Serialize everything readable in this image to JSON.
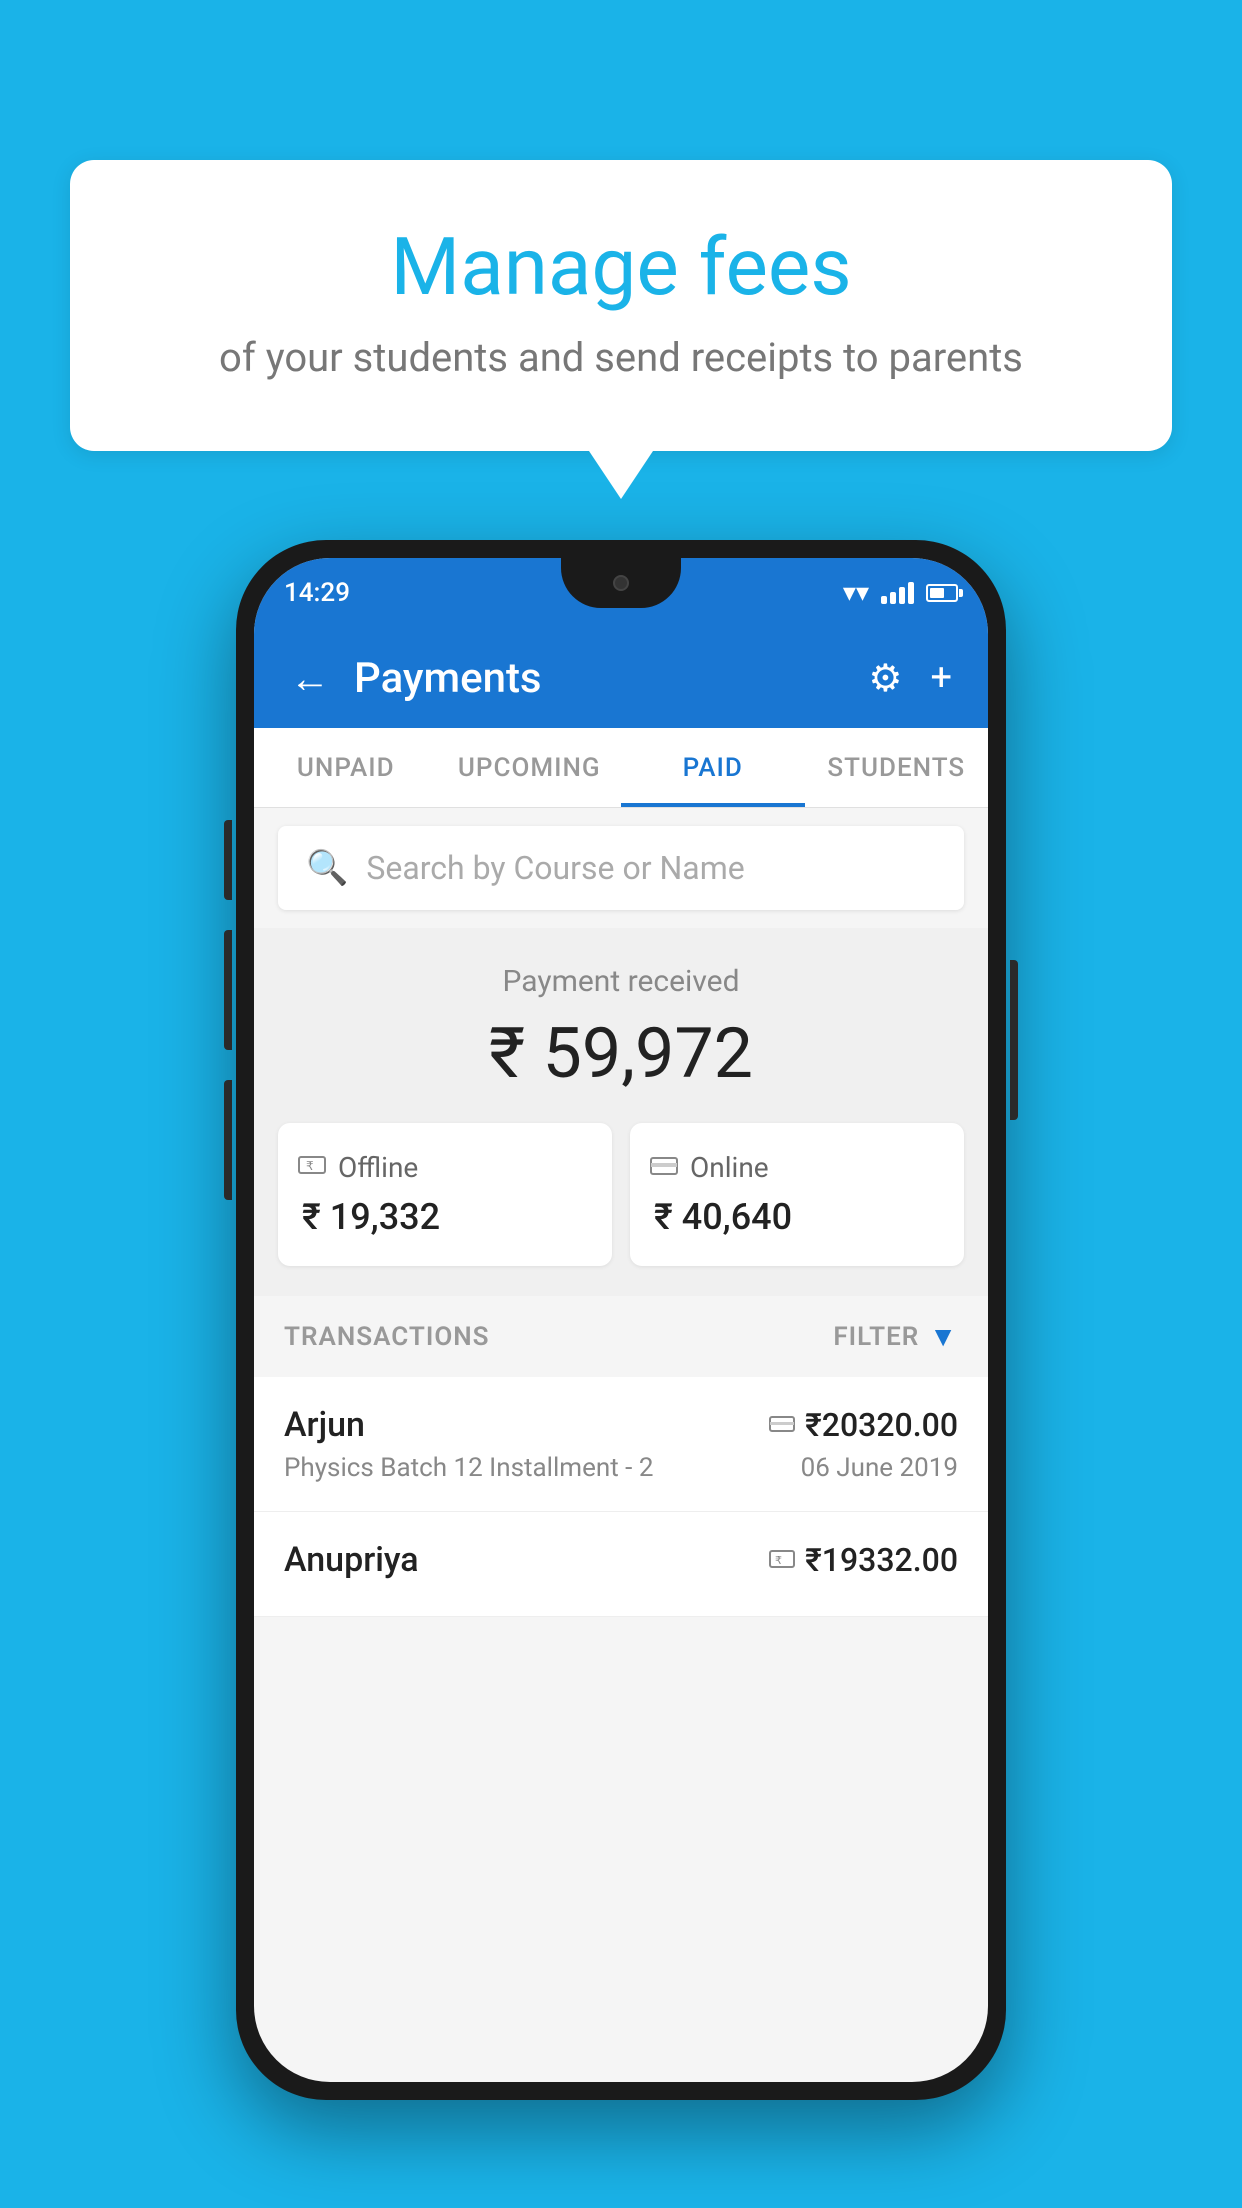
{
  "background_color": "#1ab3e8",
  "speech_bubble": {
    "title": "Manage fees",
    "subtitle": "of your students and send receipts to parents"
  },
  "status_bar": {
    "time": "14:29"
  },
  "app_header": {
    "title": "Payments",
    "settings_icon": "⚙",
    "add_icon": "+"
  },
  "tabs": [
    {
      "label": "UNPAID",
      "active": false
    },
    {
      "label": "UPCOMING",
      "active": false
    },
    {
      "label": "PAID",
      "active": true
    },
    {
      "label": "STUDENTS",
      "active": false
    }
  ],
  "search": {
    "placeholder": "Search by Course or Name"
  },
  "payment_summary": {
    "label": "Payment received",
    "total": "₹ 59,972",
    "offline": {
      "label": "Offline",
      "amount": "₹ 19,332"
    },
    "online": {
      "label": "Online",
      "amount": "₹ 40,640"
    }
  },
  "transactions": {
    "section_label": "TRANSACTIONS",
    "filter_label": "FILTER",
    "items": [
      {
        "name": "Arjun",
        "payment_type": "online",
        "amount": "₹20320.00",
        "course": "Physics Batch 12 Installment - 2",
        "date": "06 June 2019"
      },
      {
        "name": "Anupriya",
        "payment_type": "offline",
        "amount": "₹19332.00",
        "course": "",
        "date": ""
      }
    ]
  }
}
